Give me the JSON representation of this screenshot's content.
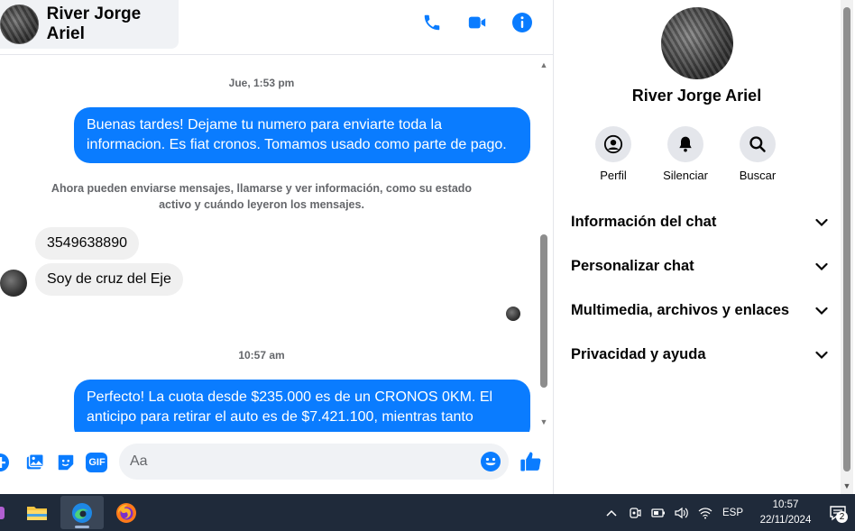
{
  "header": {
    "contact_name": "River Jorge Ariel",
    "icons": [
      "phone-icon",
      "video-call-icon",
      "info-icon"
    ]
  },
  "messages": {
    "timestamp_1": "Jue, 1:53 pm",
    "out_1": "Buenas tardes! Dejame tu numero para enviarte toda la informacion. Es fiat cronos. Tomamos usado como parte de pago.",
    "system_notice": "Ahora pueden enviarse mensajes, llamarse y ver información, como su estado activo y cuándo leyeron los mensajes.",
    "in_1": "3549638890",
    "in_2": "Soy de cruz del Eje",
    "timestamp_2": "10:57 am",
    "out_2": "Perfecto! La cuota desde $235.000 es de un CRONOS 0KM. El anticipo para retirar el auto es de $7.421.100, mientras tanto"
  },
  "composer": {
    "placeholder": "Aa",
    "icons": [
      "plus-icon",
      "image-icon",
      "sticker-icon",
      "gif-icon",
      "emoji-icon",
      "thumbs-up-icon"
    ],
    "gif_label": "GIF"
  },
  "info_panel": {
    "name": "River Jorge Ariel",
    "actions": [
      {
        "label": "Perfil",
        "icon": "profile-icon"
      },
      {
        "label": "Silenciar",
        "icon": "bell-icon"
      },
      {
        "label": "Buscar",
        "icon": "search-icon"
      }
    ],
    "sections": [
      {
        "label": "Información del chat"
      },
      {
        "label": "Personalizar chat"
      },
      {
        "label": "Multimedia, archivos y enlaces"
      },
      {
        "label": "Privacidad y ayuda"
      }
    ]
  },
  "taskbar": {
    "apps": [
      "file-explorer-icon",
      "edge-icon",
      "firefox-icon"
    ],
    "language": "ESP",
    "time": "10:57",
    "date": "22/11/2024",
    "notification_count": "2"
  },
  "colors": {
    "accent": "#0a7cff",
    "bubble_in": "#f0f0f0",
    "taskbar": "#1f2a3a"
  }
}
